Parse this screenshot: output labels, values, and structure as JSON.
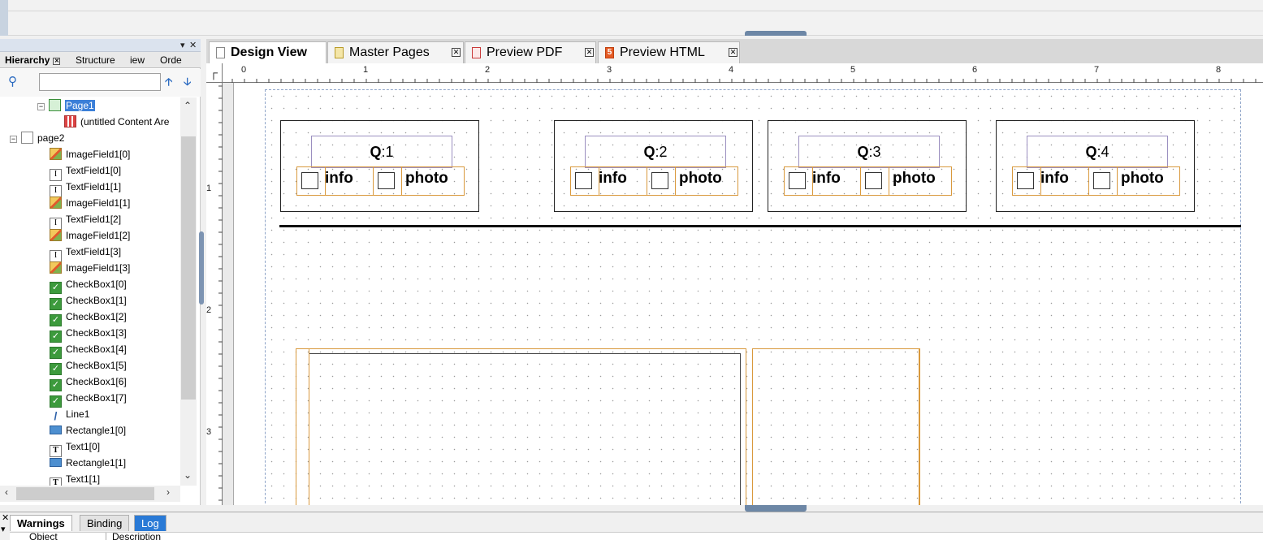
{
  "leftpanel": {
    "tabs": [
      "Hierarchy",
      "Structure",
      "iew",
      "Orde"
    ],
    "tree": [
      {
        "label": "Page1",
        "icon": "pagegreen",
        "indent": 2,
        "expander": "−",
        "selected": true
      },
      {
        "label": "(untitled Content Are",
        "icon": "content",
        "indent": 3
      },
      {
        "label": "page2",
        "icon": "page",
        "indent": 1,
        "expander": "−"
      },
      {
        "label": "ImageField1[0]",
        "icon": "image",
        "indent": 2
      },
      {
        "label": "TextField1[0]",
        "icon": "textfield",
        "indent": 2
      },
      {
        "label": "TextField1[1]",
        "icon": "textfield",
        "indent": 2
      },
      {
        "label": "ImageField1[1]",
        "icon": "image",
        "indent": 2
      },
      {
        "label": "TextField1[2]",
        "icon": "textfield",
        "indent": 2
      },
      {
        "label": "ImageField1[2]",
        "icon": "image",
        "indent": 2
      },
      {
        "label": "TextField1[3]",
        "icon": "textfield",
        "indent": 2
      },
      {
        "label": "ImageField1[3]",
        "icon": "image",
        "indent": 2
      },
      {
        "label": "CheckBox1[0]",
        "icon": "checkbox",
        "indent": 2
      },
      {
        "label": "CheckBox1[1]",
        "icon": "checkbox",
        "indent": 2
      },
      {
        "label": "CheckBox1[2]",
        "icon": "checkbox",
        "indent": 2
      },
      {
        "label": "CheckBox1[3]",
        "icon": "checkbox",
        "indent": 2
      },
      {
        "label": "CheckBox1[4]",
        "icon": "checkbox",
        "indent": 2
      },
      {
        "label": "CheckBox1[5]",
        "icon": "checkbox",
        "indent": 2
      },
      {
        "label": "CheckBox1[6]",
        "icon": "checkbox",
        "indent": 2
      },
      {
        "label": "CheckBox1[7]",
        "icon": "checkbox",
        "indent": 2
      },
      {
        "label": "Line1",
        "icon": "line",
        "indent": 2
      },
      {
        "label": "Rectangle1[0]",
        "icon": "rectangle",
        "indent": 2
      },
      {
        "label": "Text1[0]",
        "icon": "text",
        "indent": 2
      },
      {
        "label": "Rectangle1[1]",
        "icon": "rectangle",
        "indent": 2
      },
      {
        "label": "Text1[1]",
        "icon": "text",
        "indent": 2
      }
    ]
  },
  "doctabs": [
    {
      "label": "Design View",
      "icon": "page-icon",
      "active": true
    },
    {
      "label": "Master Pages",
      "icon": "master-pages-icon"
    },
    {
      "label": "Preview PDF",
      "icon": "pdf-icon"
    },
    {
      "label": "Preview HTML",
      "icon": "html5-icon"
    }
  ],
  "ruler": {
    "h_labels": [
      "0",
      "1",
      "2",
      "3",
      "4",
      "5",
      "6",
      "7",
      "8"
    ],
    "v_labels": [
      "1",
      "2",
      "3"
    ]
  },
  "canvas": {
    "questions": [
      {
        "prefix": "Q",
        "num": ":1",
        "info": "info",
        "photo": "photo"
      },
      {
        "prefix": "Q",
        "num": ":2",
        "info": "info",
        "photo": "photo"
      },
      {
        "prefix": "Q",
        "num": ":3",
        "info": "info",
        "photo": "photo"
      },
      {
        "prefix": "Q",
        "num": ":4",
        "info": "info",
        "photo": "photo"
      }
    ]
  },
  "bottompanel": {
    "tabs": [
      "Warnings",
      "Binding",
      "Log"
    ],
    "columns": [
      "Object",
      "Description"
    ]
  },
  "colors": {
    "accent": "#3b7fd8",
    "field_border": "#d9993d",
    "grip": "#6d87a6"
  }
}
